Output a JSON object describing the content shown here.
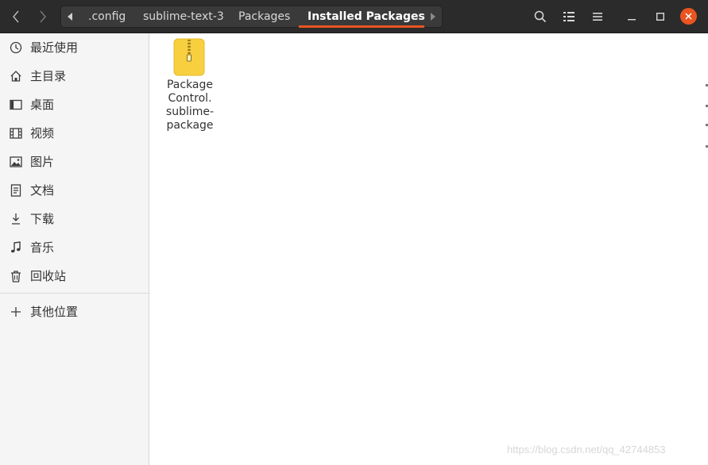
{
  "colors": {
    "header_bg": "#2b2b2b",
    "accent": "#e95420",
    "sidebar_bg": "#f5f5f5",
    "content_bg": "#ffffff"
  },
  "header": {
    "back_icon": "chevron-left-icon",
    "forward_icon": "chevron-right-icon",
    "path_scroll_left_icon": "triangle-left-icon",
    "path_scroll_right_icon": "triangle-right-icon",
    "breadcrumbs": [
      ".config",
      "sublime-text-3",
      "Packages",
      "Installed Packages"
    ],
    "active_crumb": "Installed Packages",
    "search_icon": "search-icon",
    "view_options_icon": "list-view-icon",
    "menu_icon": "hamburger-menu-icon",
    "minimize_icon": "minimize-icon",
    "maximize_icon": "maximize-icon",
    "close_icon": "close-icon"
  },
  "sidebar": {
    "items": [
      {
        "label": "最近使用",
        "icon": "clock-icon"
      },
      {
        "label": "主目录",
        "icon": "home-icon"
      },
      {
        "label": "桌面",
        "icon": "desktop-icon"
      },
      {
        "label": "视频",
        "icon": "film-icon"
      },
      {
        "label": "图片",
        "icon": "image-icon"
      },
      {
        "label": "文档",
        "icon": "document-icon"
      },
      {
        "label": "下载",
        "icon": "download-icon"
      },
      {
        "label": "音乐",
        "icon": "music-icon"
      },
      {
        "label": "回收站",
        "icon": "trash-icon"
      }
    ],
    "other_locations": {
      "label": "其他位置",
      "icon": "plus-icon"
    }
  },
  "files": [
    {
      "name": "Package\nControl.\nsublime-\npackage",
      "icon": "zip-archive-icon"
    }
  ],
  "watermark": "https://blog.csdn.net/qq_42744853"
}
